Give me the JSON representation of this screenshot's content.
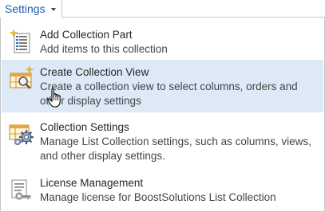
{
  "menu": {
    "trigger_label": "Settings",
    "trigger_icon": "chevron-down-icon"
  },
  "items": [
    {
      "title": "Add Collection Part",
      "description": "Add items to this collection",
      "icon": "document-list-sparkle-icon"
    },
    {
      "title": "Create Collection View",
      "description": "Create a collection view to select columns, orders and other display settings",
      "icon": "view-magnifier-sparkle-icon",
      "highlighted": true
    },
    {
      "title": "Collection Settings",
      "description": "Manage List Collection settings, such as columns, views, and other display settings.",
      "icon": "grid-gear-icon"
    },
    {
      "title": "License Management",
      "description": "Manage license for BoostSolutions List Collection",
      "icon": "license-key-icon"
    }
  ],
  "colors": {
    "link_blue": "#1f5fa8",
    "hover_background": "#dde9f6",
    "border": "#c6c6c6"
  }
}
